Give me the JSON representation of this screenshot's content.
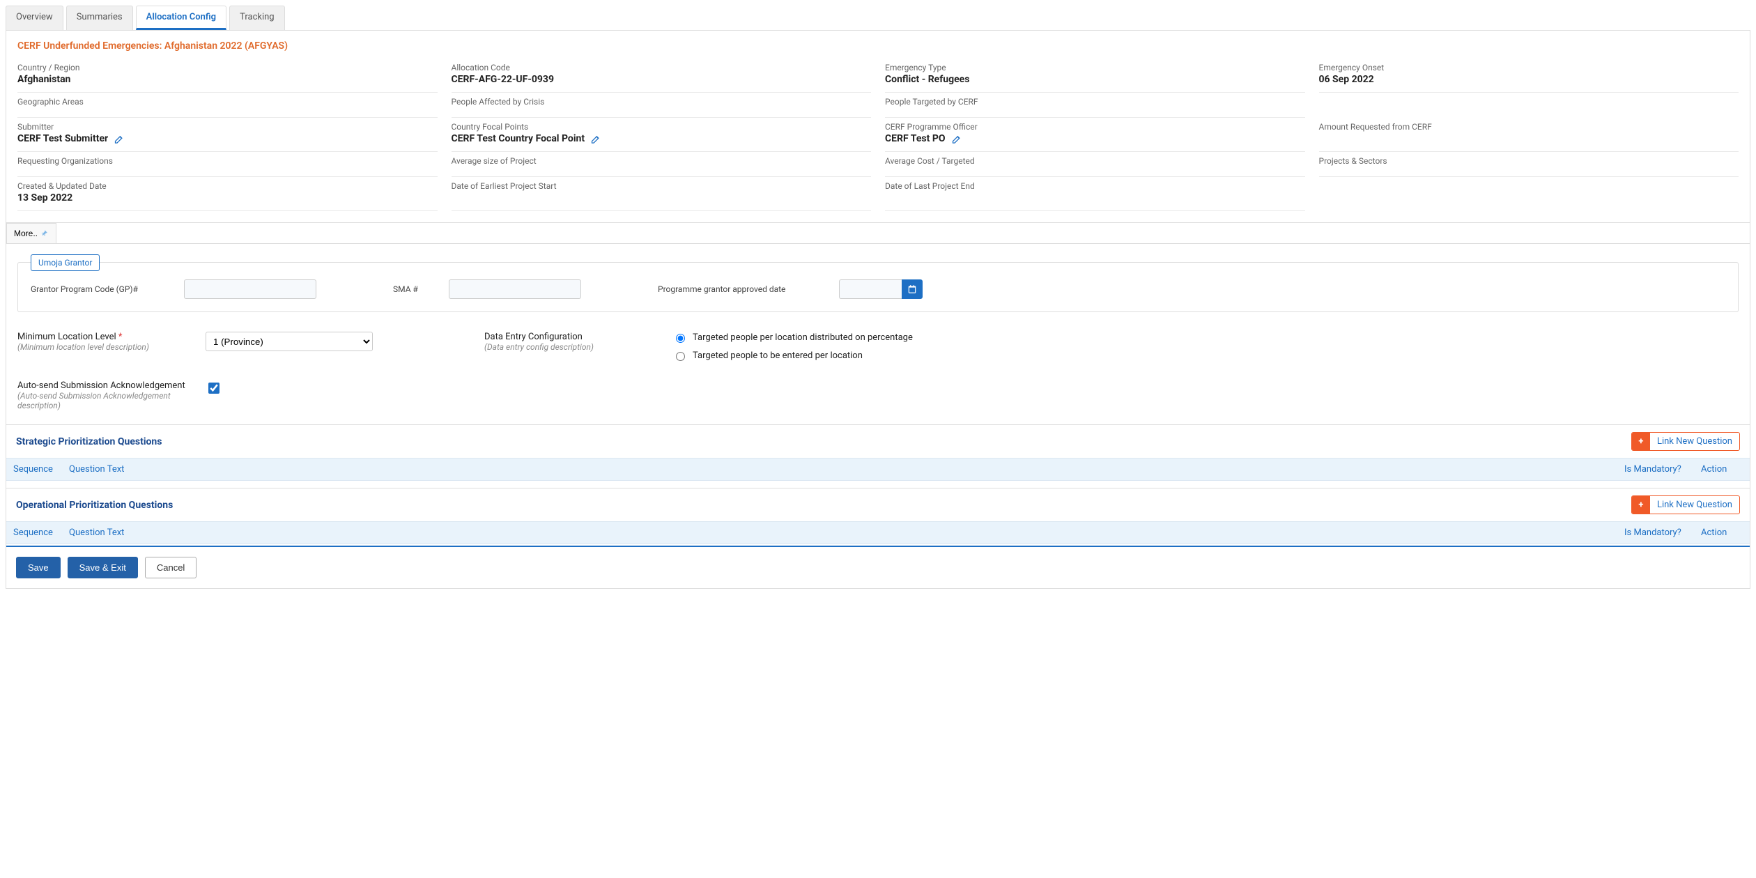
{
  "tabs": {
    "overview": "Overview",
    "summaries": "Summaries",
    "allocation": "Allocation Config",
    "tracking": "Tracking"
  },
  "pageTitle": "CERF Underfunded Emergencies: Afghanistan 2022 (AFGYAS)",
  "info": {
    "countryRegionLabel": "Country / Region",
    "countryRegion": "Afghanistan",
    "allocationCodeLabel": "Allocation Code",
    "allocationCode": "CERF-AFG-22-UF-0939",
    "emergencyTypeLabel": "Emergency Type",
    "emergencyType": "Conflict - Refugees",
    "emergencyOnsetLabel": "Emergency Onset",
    "emergencyOnset": "06 Sep 2022",
    "geoAreasLabel": "Geographic Areas",
    "peopleAffectedLabel": "People Affected by Crisis",
    "peopleTargetedLabel": "People Targeted by CERF",
    "submitterLabel": "Submitter",
    "submitter": "CERF Test Submitter",
    "countryFocalLabel": "Country Focal Points",
    "countryFocal": "CERF Test Country Focal Point",
    "programmeOfficerLabel": "CERF Programme Officer",
    "programmeOfficer": "CERF Test PO",
    "amountRequestedLabel": "Amount Requested from CERF",
    "requestingOrgsLabel": "Requesting Organizations",
    "avgSizeLabel": "Average size of Project",
    "avgCostLabel": "Average Cost / Targeted",
    "projectsSectorsLabel": "Projects & Sectors",
    "createdUpdatedLabel": "Created & Updated Date",
    "createdUpdated": "13 Sep 2022",
    "earliestStartLabel": "Date of Earliest Project Start",
    "lastEndLabel": "Date of Last Project End"
  },
  "moreLabel": "More..",
  "umoja": {
    "tabLabel": "Umoja Grantor",
    "gpLabel": "Grantor Program Code (GP)#",
    "smaLabel": "SMA #",
    "approvedDateLabel": "Programme grantor approved date"
  },
  "config": {
    "minLocLabel": "Minimum Location Level",
    "minLocDesc": "(Minimum location level description)",
    "minLocValue": "1 (Province)",
    "dataEntryLabel": "Data Entry Configuration",
    "dataEntryDesc": "(Data entry config description)",
    "radio1": "Targeted people per location distributed on percentage",
    "radio2": "Targeted people to be entered per location",
    "autoSendLabel": "Auto-send Submission Acknowledgement",
    "autoSendDesc": "(Auto-send Submission Acknowledgement description)"
  },
  "sections": {
    "strategic": "Strategic Prioritization Questions",
    "operational": "Operational Prioritization Questions",
    "linkNew": "Link New Question",
    "colSeq": "Sequence",
    "colText": "Question Text",
    "colMand": "Is Mandatory?",
    "colAction": "Action"
  },
  "actions": {
    "save": "Save",
    "saveExit": "Save & Exit",
    "cancel": "Cancel"
  }
}
